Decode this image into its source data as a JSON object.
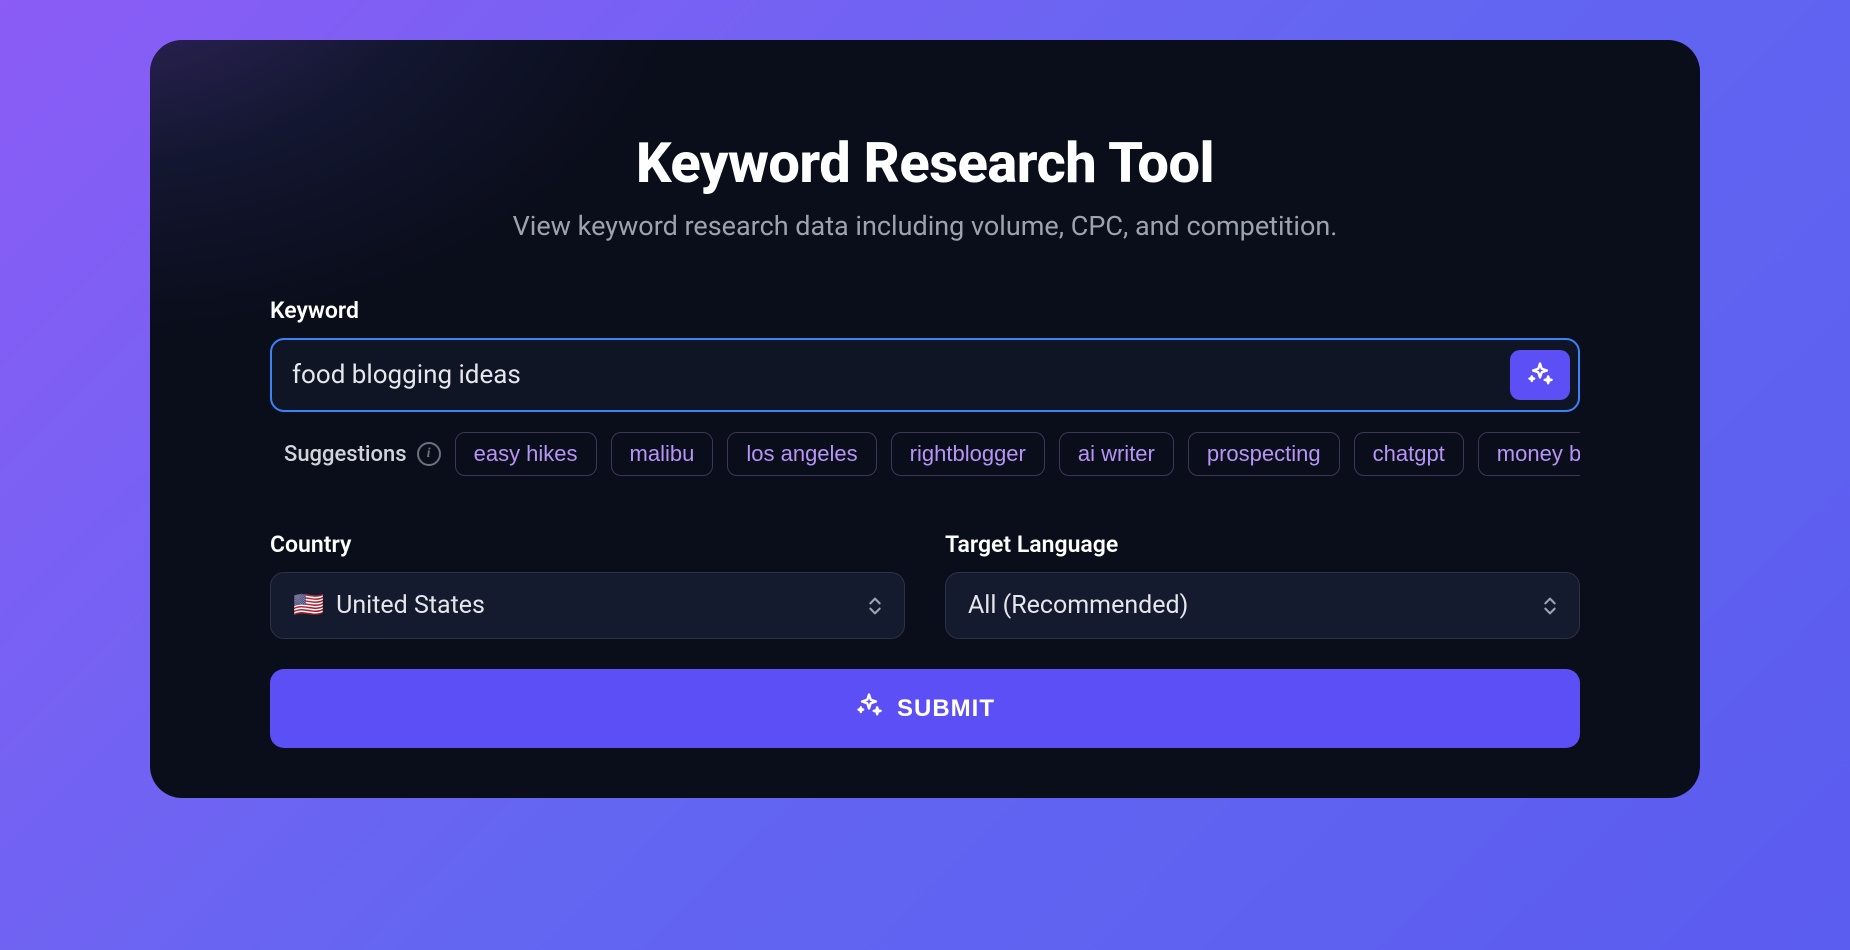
{
  "header": {
    "title": "Keyword Research Tool",
    "subtitle": "View keyword research data including volume, CPC, and competition."
  },
  "form": {
    "keyword_label": "Keyword",
    "keyword_value": "food blogging ideas",
    "suggestions_label": "Suggestions",
    "suggestions": [
      "easy hikes",
      "malibu",
      "los angeles",
      "rightblogger",
      "ai writer",
      "prospecting",
      "chatgpt",
      "money blogging"
    ],
    "country_label": "Country",
    "country_flag": "🇺🇸",
    "country_value": "United States",
    "language_label": "Target Language",
    "language_value": "All (Recommended)",
    "submit_label": "SUBMIT"
  }
}
